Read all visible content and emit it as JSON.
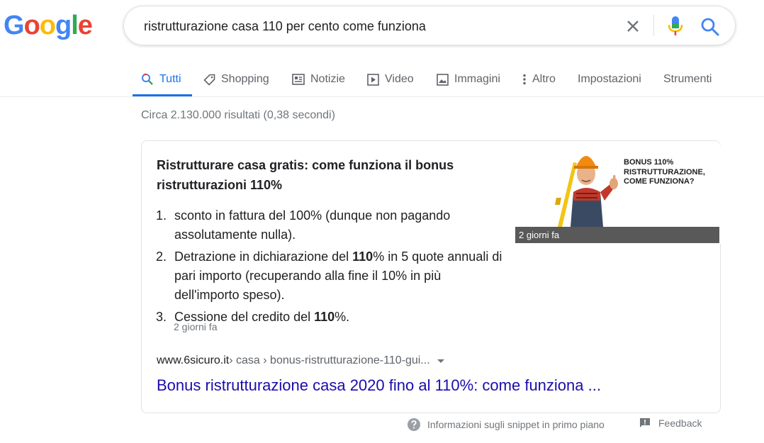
{
  "logo": {
    "text": "Google",
    "letters": [
      "G",
      "o",
      "o",
      "g",
      "l",
      "e"
    ],
    "colors": [
      "#4285f4",
      "#ea4335",
      "#fbbc05",
      "#4285f4",
      "#34a853",
      "#ea4335"
    ]
  },
  "search": {
    "query": "ristrutturazione casa 110 per cento come funziona"
  },
  "tabs": [
    {
      "label": "Tutti",
      "icon": "search-icon",
      "active": true
    },
    {
      "label": "Shopping",
      "icon": "tag-icon"
    },
    {
      "label": "Notizie",
      "icon": "news-icon"
    },
    {
      "label": "Video",
      "icon": "play-icon"
    },
    {
      "label": "Immagini",
      "icon": "image-icon"
    },
    {
      "label": "Altro",
      "icon": "more-vert-icon"
    },
    {
      "label": "Impostazioni"
    },
    {
      "label": "Strumenti"
    }
  ],
  "stats": "Circa 2.130.000 risultati (0,38 secondi)",
  "snippet": {
    "title": "Ristrutturare casa gratis: come funziona il bonus ristrutturazioni 110%",
    "items": [
      {
        "num": "1.",
        "text": "sconto in fattura del 100% (dunque non pagando assolutamente nulla)."
      },
      {
        "num": "2.",
        "pre": "Detrazione in dichiarazione del ",
        "bold": "110",
        "post": "% in 5 quote annuali di pari importo (recuperando alla fine il 10% in più dell'importo speso)."
      },
      {
        "num": "3.",
        "pre": "Cessione del credito del ",
        "bold": "110",
        "post": "%."
      }
    ],
    "date": "2 giorni fa",
    "image": {
      "caption": "2 giorni fa",
      "text": "BONUS 110%\nRISTRUTTURAZIONE,\nCOME FUNZIONA?"
    },
    "cite": {
      "domain": "www.6sicuro.it",
      "path": " › casa › bonus-ristrutturazione-110-gui..."
    },
    "link": "Bonus ristrutturazione casa 2020 fino al 110%: come funziona ..."
  },
  "footer": {
    "info": "Informazioni sugli snippet in primo piano",
    "feedback": "Feedback"
  },
  "colors": {
    "accent": "#1a73e8",
    "link": "#1a0dab"
  }
}
